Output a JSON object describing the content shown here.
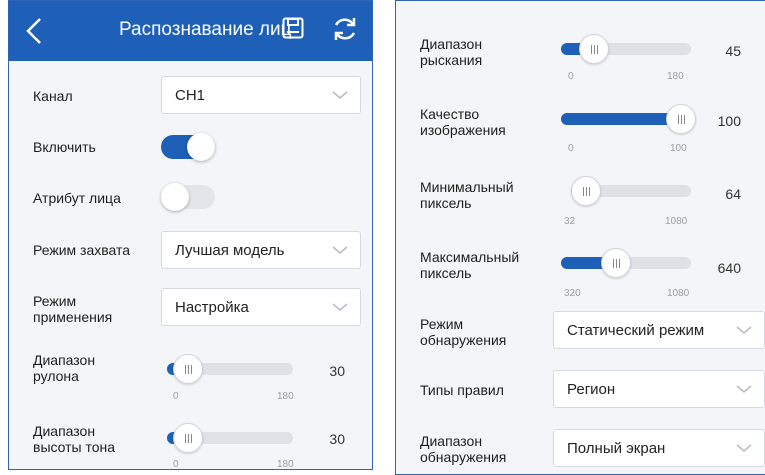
{
  "left": {
    "header": {
      "title": "Распознавание лиц"
    },
    "channel": {
      "label": "Канал",
      "value": "CH1"
    },
    "enable": {
      "label": "Включить",
      "on": true
    },
    "face_attr": {
      "label": "Атрибут лица",
      "on": false
    },
    "capture_mode": {
      "label": "Режим захвата",
      "value": "Лучшая модель"
    },
    "apply_mode": {
      "label1": "Режим",
      "label2": "применения",
      "value": "Настройка"
    },
    "roll": {
      "label1": "Диапазон",
      "label2": "рулона",
      "min": "0",
      "max": "180",
      "value": "30",
      "level": 0.1667
    },
    "pitch": {
      "label1": "Диапазон",
      "label2": "высоты тона",
      "min": "0",
      "max": "180",
      "value": "30",
      "level": 0.1667
    }
  },
  "right": {
    "yaw": {
      "label1": "Диапазон",
      "label2": "рыскания",
      "min": "0",
      "max": "180",
      "value": "45",
      "level": 0.25
    },
    "quality": {
      "label1": "Качество",
      "label2": "изображения",
      "min": "0",
      "max": "100",
      "value": "100",
      "level": 1.0
    },
    "min_pixel": {
      "label1": "Минимальный",
      "label2": "пиксель",
      "min": "32",
      "max": "1080",
      "value": "64",
      "level": 0.0305
    },
    "max_pixel": {
      "label1": "Максимальный",
      "label2": "пиксель",
      "min": "320",
      "max": "1080",
      "value": "640",
      "level": 0.421
    },
    "detect_mode": {
      "label1": "Режим",
      "label2": "обнаружения",
      "value": "Статический режим"
    },
    "rule_types": {
      "label": "Типы правил",
      "value": "Регион"
    },
    "detect_range": {
      "label1": "Диапазон",
      "label2": "обнаружения",
      "value": "Полный экран"
    }
  },
  "colors": {
    "accent": "#1e5fb8",
    "toggle_off": "#e3e5ea",
    "track": "#dfe1e6"
  }
}
